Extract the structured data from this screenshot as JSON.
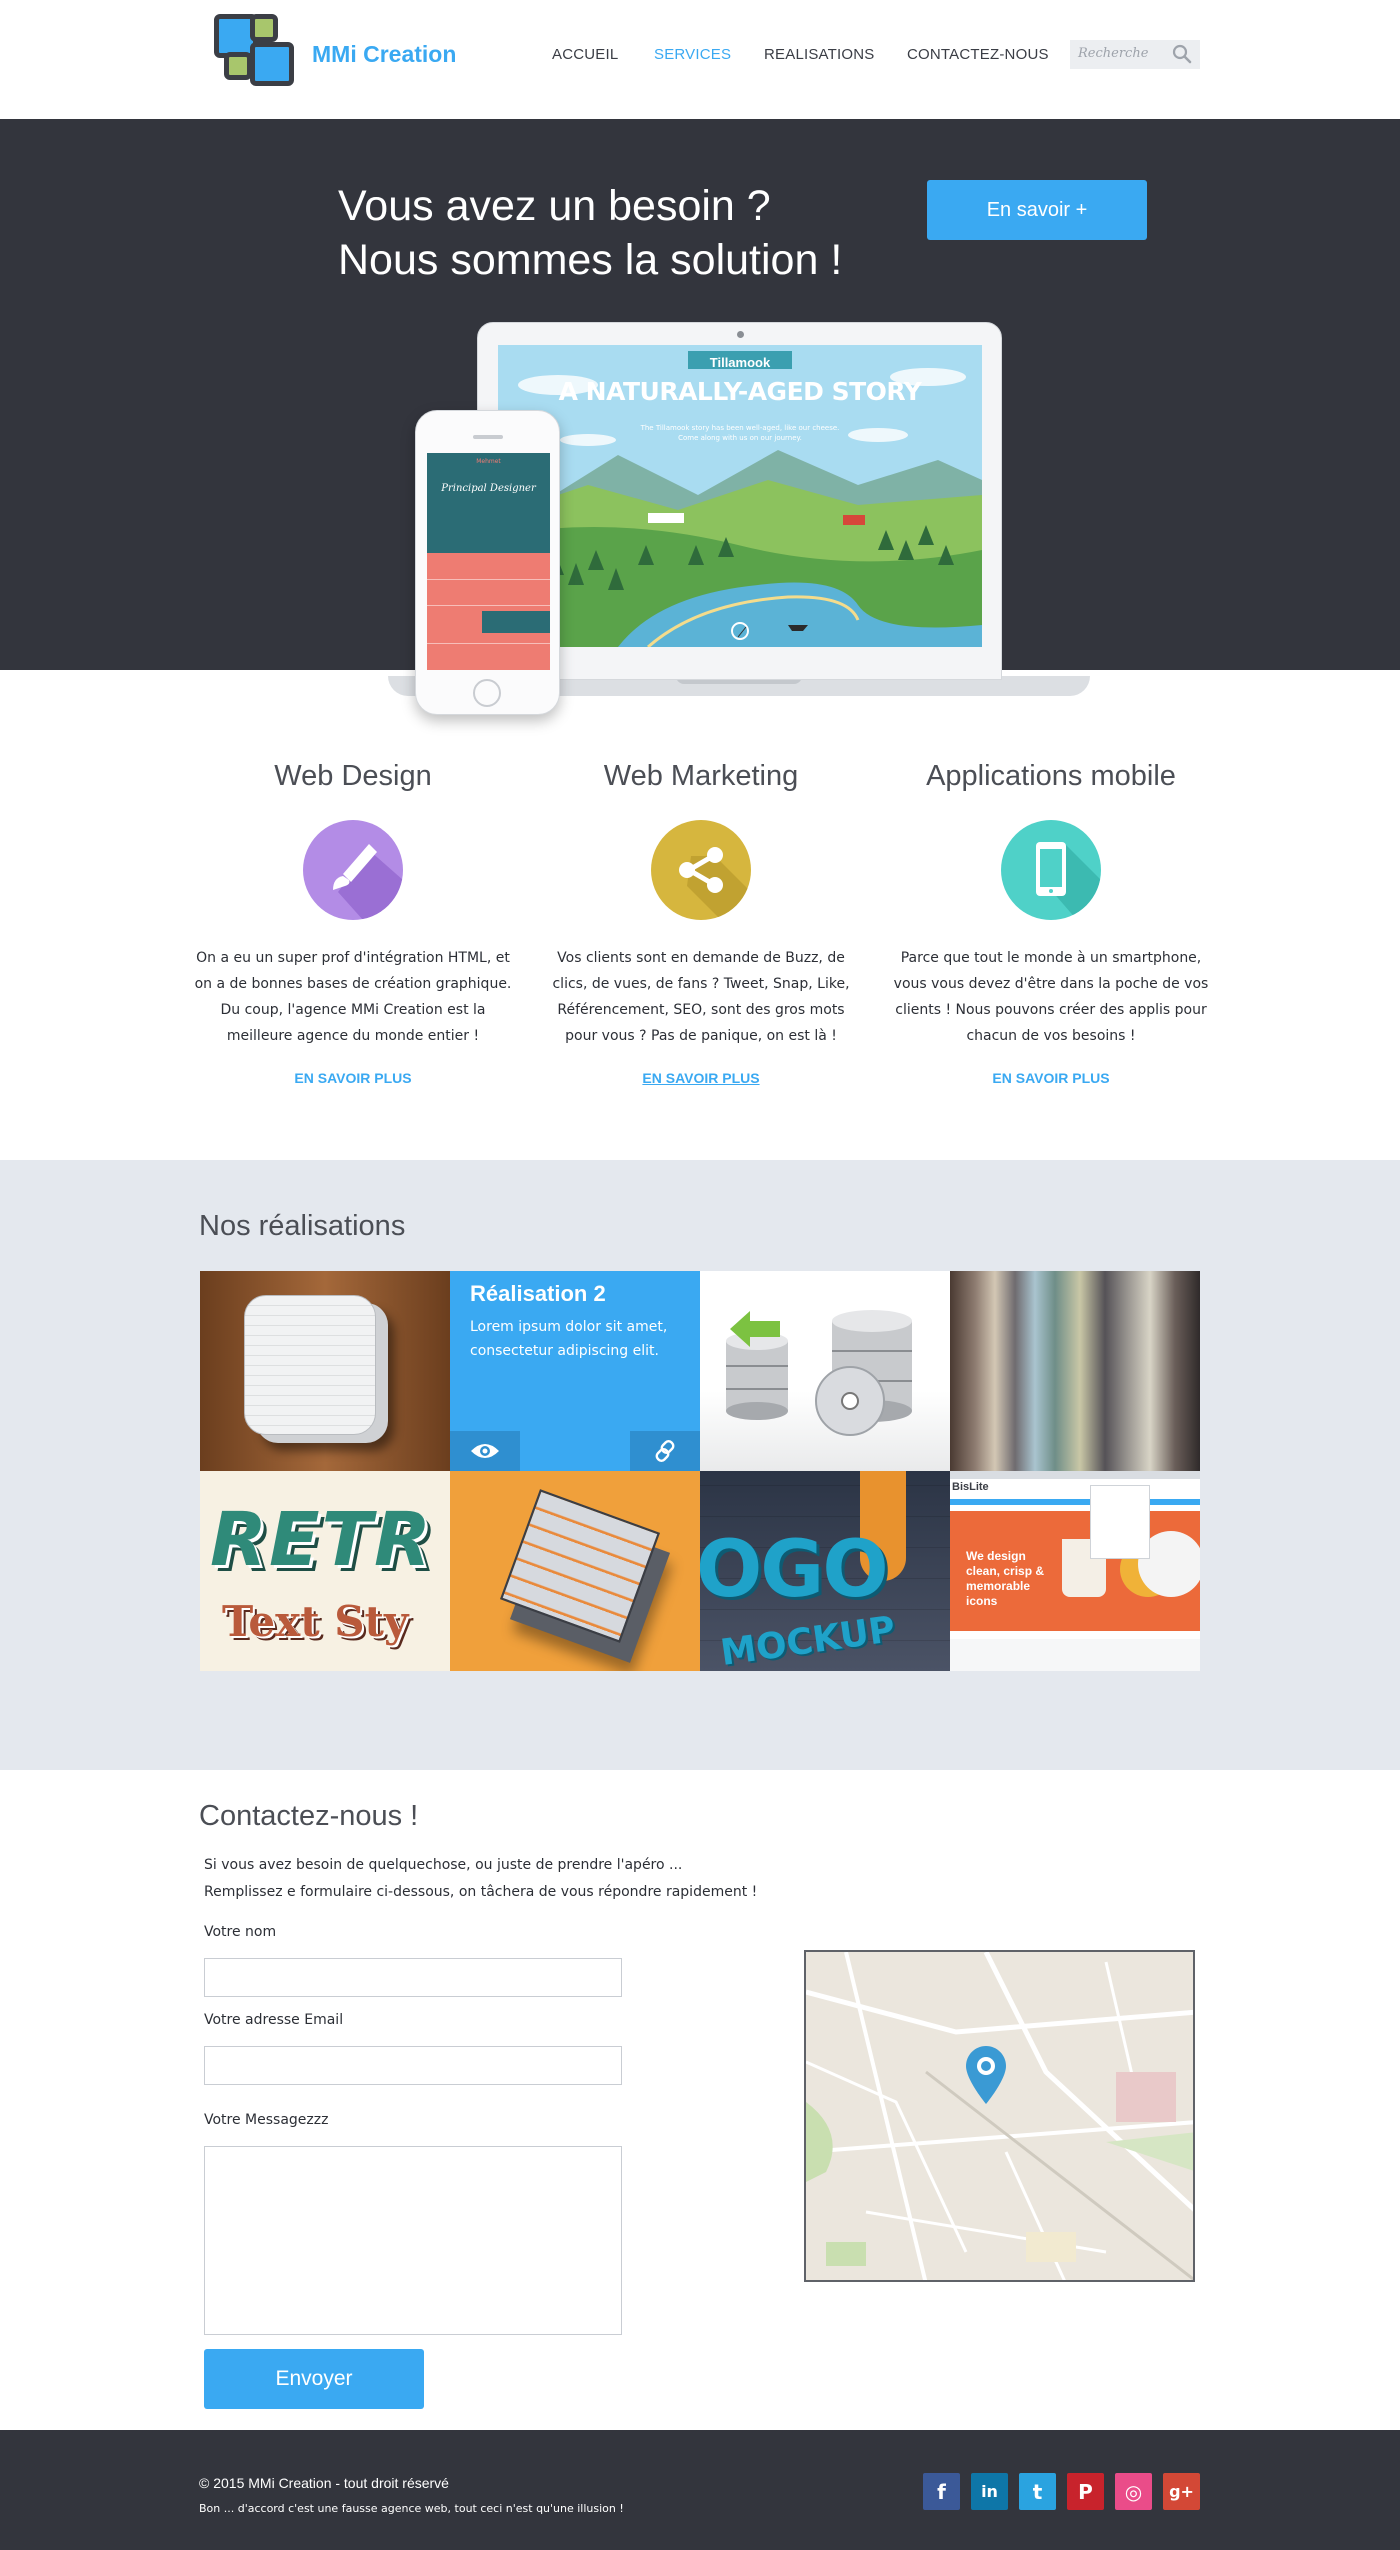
{
  "brand": {
    "name": "MMi Creation",
    "accent": "#3aa9f2",
    "dark": "#33353d"
  },
  "nav": {
    "items": [
      {
        "label": "ACCUEIL",
        "active": false
      },
      {
        "label": "SERVICES",
        "active": true
      },
      {
        "label": "REALISATIONS",
        "active": false
      },
      {
        "label": "CONTACTEZ-NOUS",
        "active": false
      }
    ],
    "search_placeholder": "Recherche",
    "search_icon": "search-icon"
  },
  "hero": {
    "title": "Vous avez un besoin ?\nNous sommes la solution !",
    "button_label": "En savoir +",
    "laptop_headline": "A NATURALLY-AGED STORY",
    "laptop_brand": "Tillamook",
    "laptop_sub": "The Tillamook story has been well-aged, like our cheese.\nCome along with us on our journey.",
    "phone_title": "Principal Designer",
    "phone_brand": "Mehmet"
  },
  "services": [
    {
      "title": "Web Design",
      "icon": "paint-brush-icon",
      "color": "#b38ce6",
      "text": "On a eu un super prof d'intégration HTML, et on a de bonnes bases de création graphique. Du coup, l'agence MMi Creation est la meilleure agence du monde entier !",
      "link": "EN SAVOIR PLUS"
    },
    {
      "title": "Web Marketing",
      "icon": "share-icon",
      "color": "#d6b63e",
      "text": "Vos clients sont en demande de Buzz, de clics, de vues, de fans ? Tweet, Snap, Like, Référencement, SEO, sont des gros mots pour vous ? Pas de panique, on est là !",
      "link": "EN SAVOIR PLUS"
    },
    {
      "title": "Applications mobile",
      "icon": "smartphone-icon",
      "color": "#4fd1c8",
      "text": "Parce que tout le monde à un smartphone, vous vous devez d'être dans la poche de vos clients ! Nous pouvons créer des applis pour chacun de vos besoins !",
      "link": "EN SAVOIR PLUS"
    }
  ],
  "works": {
    "title": "Nos réalisations",
    "featured_title": "Réalisation 2",
    "featured_text": "Lorem ipsum dolor sit amet, consectetur adipiscing elit.",
    "retro_line1": "RETR",
    "retro_line2": "Text Sty",
    "mockup_line1": "OGO",
    "mockup_line2": "MOCKUP",
    "bis_brand": "BisLite",
    "bis_text": "We design clean, crisp & memorable icons"
  },
  "contact": {
    "title": "Contactez-nous !",
    "intro": "Si vous avez besoin de quelquechose, ou juste de prendre l'apéro ...\nRemplissez e formulaire ci-dessous, on tâchera de vous répondre rapidement !",
    "name_label": "Votre nom",
    "email_label": "Votre adresse Email",
    "message_label": "Votre Messagezzz",
    "send_label": "Envoyer"
  },
  "footer": {
    "copyright": "© 2015 MMi Creation - tout droit réservé",
    "disclaimer": "Bon ... d'accord c'est une fausse agence web, tout ceci n'est qu'une illusion !",
    "social": [
      {
        "icon": "facebook-icon",
        "glyph": "f",
        "color": "#3b5998"
      },
      {
        "icon": "linkedin-icon",
        "glyph": "in",
        "color": "#0e76a8"
      },
      {
        "icon": "twitter-icon",
        "glyph": "t",
        "color": "#2aa3e0"
      },
      {
        "icon": "pinterest-icon",
        "glyph": "P",
        "color": "#c8232c"
      },
      {
        "icon": "dribbble-icon",
        "glyph": "◎",
        "color": "#ea4c89"
      },
      {
        "icon": "google-plus-icon",
        "glyph": "g+",
        "color": "#d34836"
      }
    ]
  }
}
